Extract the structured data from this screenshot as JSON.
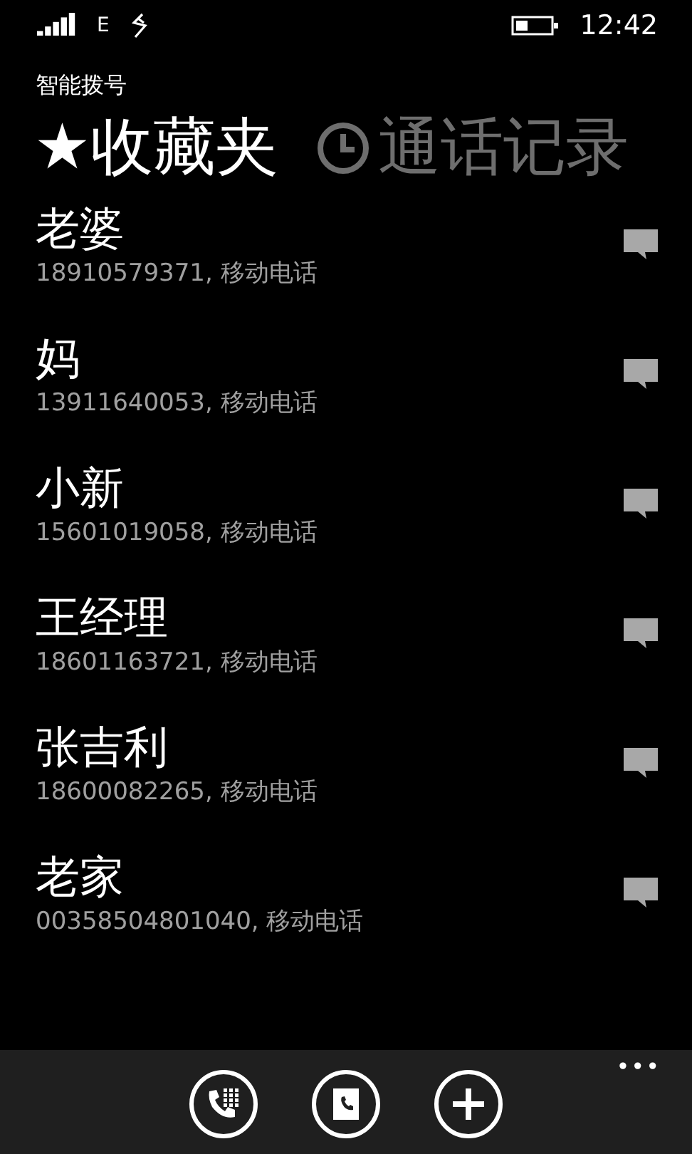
{
  "status_bar": {
    "network": "E",
    "time": "12:42"
  },
  "app_title": "智能拨号",
  "tabs": [
    {
      "kind": "favorites",
      "glyph": "★",
      "label": "收藏夹",
      "selected": true
    },
    {
      "kind": "history",
      "label": "通话记录",
      "selected": false
    }
  ],
  "contacts": [
    {
      "name": "老婆",
      "detail": "18910579371, 移动电话"
    },
    {
      "name": "妈",
      "detail": "13911640053, 移动电话"
    },
    {
      "name": "小新",
      "detail": "15601019058, 移动电话"
    },
    {
      "name": "王经理",
      "detail": "18601163721, 移动电话"
    },
    {
      "name": "张吉利",
      "detail": "18600082265, 移动电话"
    },
    {
      "name": "老家",
      "detail": "00358504801040, 移动电话"
    }
  ],
  "app_bar": {
    "buttons": [
      {
        "kind": "dialpad"
      },
      {
        "kind": "contacts"
      },
      {
        "kind": "add"
      }
    ],
    "more": "•••"
  }
}
